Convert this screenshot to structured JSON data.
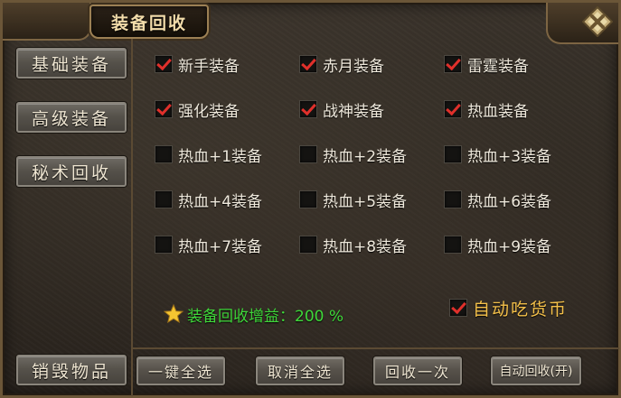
{
  "title": "装备回收",
  "sidebar": {
    "items": [
      {
        "label": "基础装备"
      },
      {
        "label": "高级装备"
      },
      {
        "label": "秘术回收"
      }
    ],
    "destroy_label": "销毁物品"
  },
  "options": [
    {
      "label": "新手装备",
      "checked": true
    },
    {
      "label": "赤月装备",
      "checked": true
    },
    {
      "label": "雷霆装备",
      "checked": true
    },
    {
      "label": "强化装备",
      "checked": true
    },
    {
      "label": "战神装备",
      "checked": true
    },
    {
      "label": "热血装备",
      "checked": true
    },
    {
      "label": "热血+1装备",
      "checked": false
    },
    {
      "label": "热血+2装备",
      "checked": false
    },
    {
      "label": "热血+3装备",
      "checked": false
    },
    {
      "label": "热血+4装备",
      "checked": false
    },
    {
      "label": "热血+5装备",
      "checked": false
    },
    {
      "label": "热血+6装备",
      "checked": false
    },
    {
      "label": "热血+7装备",
      "checked": false
    },
    {
      "label": "热血+8装备",
      "checked": false
    },
    {
      "label": "热血+9装备",
      "checked": false
    }
  ],
  "bonus": {
    "text": "装备回收增益：200 %"
  },
  "auto_coin": {
    "label": "自动吃货币",
    "checked": true
  },
  "actions": {
    "select_all": "一键全选",
    "deselect_all": "取消全选",
    "recycle_once": "回收一次",
    "auto_recycle": "自动回收(开)"
  },
  "colors": {
    "check_mark": "#e0302b",
    "bonus_text": "#3fd83a",
    "auto_coin_text": "#f4c04a"
  }
}
